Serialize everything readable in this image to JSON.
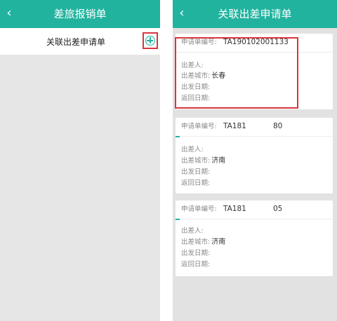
{
  "left_screen": {
    "title": "差旅报销单",
    "back_glyph": "‹",
    "subbar_label": "关联出差申请单"
  },
  "right_screen": {
    "title": "关联出差申请单",
    "back_glyph": "‹",
    "labels": {
      "app_no": "申请单编号:",
      "traveler": "出差人:",
      "city": "出差城市:",
      "depart": "出发日期:",
      "return": "返回日期:"
    },
    "cards": [
      {
        "app_no": "TA190102001133",
        "traveler": "",
        "city": "长春",
        "depart": "",
        "return": ""
      },
      {
        "app_no": "TA181",
        "app_no_tail": "80",
        "traveler": "",
        "city": "济南",
        "depart": "",
        "return": ""
      },
      {
        "app_no": "TA181",
        "app_no_tail": "05",
        "traveler": "",
        "city": "济南",
        "depart": "",
        "return": ""
      }
    ]
  },
  "colors": {
    "header": "#22b39f",
    "highlight": "#d9363e",
    "background": "#e6e6e6"
  }
}
